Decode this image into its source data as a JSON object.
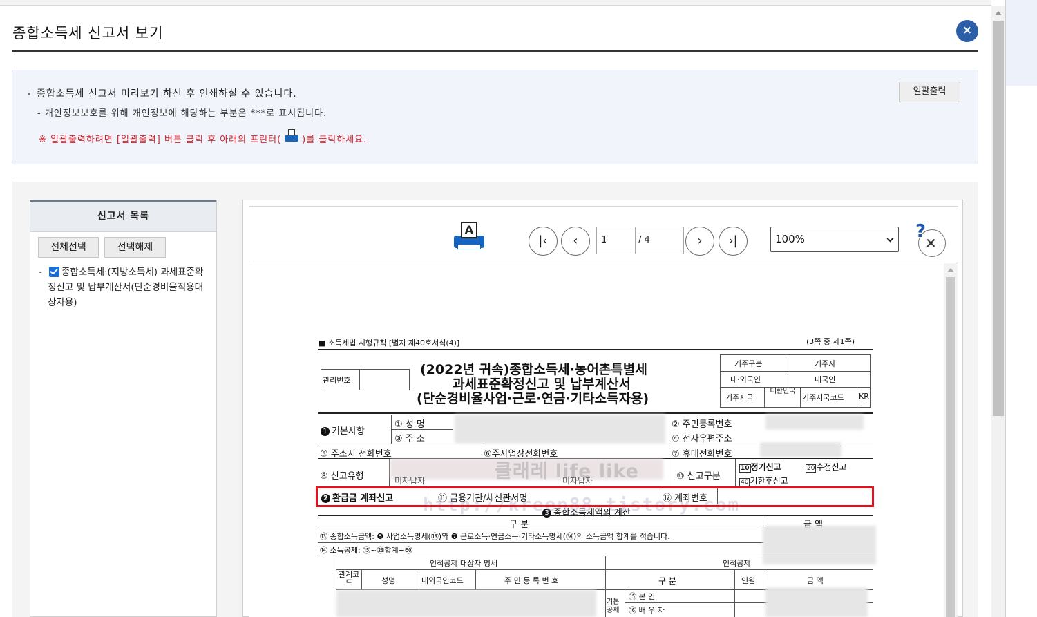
{
  "dialog": {
    "title": "종합소득세 신고서 보기",
    "close": "×"
  },
  "info": {
    "line1": "종합소득세 신고서 미리보기 하신 후 인쇄하실 수 있습니다.",
    "line2": "- 개인정보보호를 위해 개인정보에 해당하는 부분은 ***로 표시됩니다.",
    "line3_before": "※ 일괄출력하려면 [일괄출력] 버튼 클릭 후 아래의 프린터(",
    "line3_after": ")를 클릭하세요.",
    "bulk_print": "일괄출력",
    "printer_icon": "printer-icon"
  },
  "list": {
    "title": "신고서 목록",
    "select_all": "전체선택",
    "deselect": "선택해제",
    "item": "종합소득세·(지방소득세) 과세표준확정신고 및 납부계산서(단순경비율적용대상자용)",
    "item_checked": true
  },
  "viewer": {
    "page_current": "1",
    "page_total": "/ 4",
    "zoom": "100%",
    "first_icon": "first-page-icon",
    "prev_icon": "prev-page-icon",
    "next_icon": "next-page-icon",
    "last_icon": "last-page-icon",
    "help_icon": "help-icon"
  },
  "doc": {
    "law": "■ 소득세법 시행규칙 [별지 제40호서식(4)]",
    "page_of": "(3쪽 중 제1쪽)",
    "mgmt_no": "관리번호",
    "title1": "(2022년 귀속)종합소득세·농어촌특별세",
    "title2": "과세표준확정신고 및 납부계산서",
    "title3": "(단순경비율사업·근로·연금·기타소득자용)",
    "res_type": "거주구분",
    "res_value": "거주자",
    "nat_type": "내·외국인",
    "nat_value": "내국인",
    "res_country": "거주지국",
    "res_country_value": "대한민국",
    "res_country_code": "거주지국코드",
    "res_country_code_value": "KR",
    "basic": "기본사항",
    "name": "① 성      명",
    "address": "③ 주      소",
    "rrn": "② 주민등록번호",
    "email": "④ 전자우편주소",
    "home_phone": "⑤ 주소지 전화번호",
    "biz_phone": "⑥주사업장전화번호",
    "mobile": "⑦ 휴대전화번호",
    "report_type": "⑧ 신고유형",
    "report_type_val": "미자납자",
    "report_type_val2": "미자납자",
    "report_kind": "⑩ 신고구분",
    "regular": "정기신고",
    "regular_no": "10",
    "amend": "수정신고",
    "amend_no": "20",
    "late": "기한후신고",
    "late_no": "40",
    "refund": "환급금 계좌신고",
    "bank": "⑪ 금융기관/체신관서명",
    "account": "⑫ 계좌번호",
    "calc": "종합소득세액의 계산",
    "gubun": "구         분",
    "amount": "금      액",
    "row13": "⑬ 종합소득금액: ❺ 사업소득명세(⑱)와 ❼ 근로소득·연금소득·기타소득명세(㉞)의 소득금액 합계를 적습니다.",
    "row14": "⑭ 소득공제: ⑮~㉓합계−㊿",
    "deduct_target": "인적공제 대상자 명세",
    "deduct": "인적공제",
    "rel_code": "관계코드",
    "person_name": "성명",
    "foreign_code": "내외국인코드",
    "person_rrn": "주 민 등 록 번 호",
    "gubun2": "구  분",
    "count": "인원",
    "amount2": "금  액",
    "basic_deduct": "기본공제",
    "self": "⑮ 본     인",
    "spouse": "⑯ 배  우  자"
  },
  "watermark": {
    "text1": "클래레 life like",
    "text2": "http://kreen88.tistory.com"
  }
}
